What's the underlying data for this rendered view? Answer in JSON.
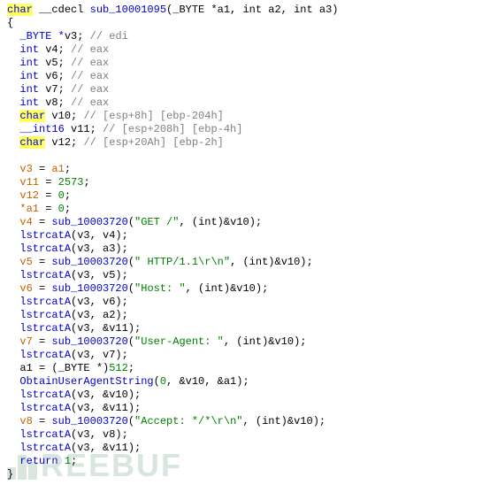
{
  "watermark": "REEBUF",
  "code": {
    "func_signature": {
      "ret_kw": "char",
      "cc": " __cdecl ",
      "name": "sub_10001095",
      "params": "(_BYTE *a1, int a2, int a3)"
    },
    "decl": [
      {
        "type": "_BYTE *",
        "name": "v3",
        "comment": "// edi"
      },
      {
        "type": "int ",
        "name": "v4",
        "comment": "// eax"
      },
      {
        "type": "int ",
        "name": "v5",
        "comment": "// eax"
      },
      {
        "type": "int ",
        "name": "v6",
        "comment": "// eax"
      },
      {
        "type": "int ",
        "name": "v7",
        "comment": "// eax"
      },
      {
        "type": "int ",
        "name": "v8",
        "comment": "// eax"
      },
      {
        "type_hl": "char",
        "type_rest": " ",
        "name": "v10",
        "comment": "// [esp+8h] [ebp-204h]"
      },
      {
        "type": "__int16 ",
        "name": "v11",
        "comment": "// [esp+208h] [ebp-4h]"
      },
      {
        "type_hl": "char",
        "type_rest": " ",
        "name": "v12",
        "comment": "// [esp+20Ah] [ebp-2h]"
      }
    ],
    "body": [
      {
        "t": "assign",
        "lhs": "v3",
        "op": " = ",
        "rhs_var": "a1"
      },
      {
        "t": "assign",
        "lhs": "v11",
        "op": " = ",
        "rhs_num": "2573"
      },
      {
        "t": "assign",
        "lhs": "v12",
        "op": " = ",
        "rhs_num": "0"
      },
      {
        "t": "assign",
        "lhs": "*a1",
        "op": " = ",
        "rhs_num": "0"
      },
      {
        "t": "call_assign",
        "lhs": "v4",
        "fn": "sub_10003720",
        "str": "\"GET /\"",
        "rest": ", (int)&v10"
      },
      {
        "t": "call",
        "fn": "lstrcatA",
        "args": "(v3, v4)"
      },
      {
        "t": "call",
        "fn": "lstrcatA",
        "args": "(v3, a3)"
      },
      {
        "t": "call_assign",
        "lhs": "v5",
        "fn": "sub_10003720",
        "str": "\" HTTP/1.1\\r\\n\"",
        "rest": ", (int)&v10"
      },
      {
        "t": "call",
        "fn": "lstrcatA",
        "args": "(v3, v5)"
      },
      {
        "t": "call_assign",
        "lhs": "v6",
        "fn": "sub_10003720",
        "str": "\"Host: \"",
        "rest": ", (int)&v10"
      },
      {
        "t": "call",
        "fn": "lstrcatA",
        "args": "(v3, v6)"
      },
      {
        "t": "call",
        "fn": "lstrcatA",
        "args": "(v3, a2)"
      },
      {
        "t": "call",
        "fn": "lstrcatA",
        "args": "(v3, &v11)"
      },
      {
        "t": "call_assign",
        "lhs": "v7",
        "fn": "sub_10003720",
        "str": "\"User-Agent: \"",
        "rest": ", (int)&v10"
      },
      {
        "t": "call",
        "fn": "lstrcatA",
        "args": "(v3, v7)"
      },
      {
        "t": "plain",
        "txt_pre": "a1 = (_BYTE *)",
        "num": "512",
        "txt_post": ";"
      },
      {
        "t": "call",
        "fn": "ObtainUserAgentString",
        "args_mixed": {
          "pre": "(",
          "num": "0",
          "post": ", &v10, &a1)"
        }
      },
      {
        "t": "call",
        "fn": "lstrcatA",
        "args": "(v3, &v10)"
      },
      {
        "t": "call",
        "fn": "lstrcatA",
        "args": "(v3, &v11)"
      },
      {
        "t": "call_assign",
        "lhs": "v8",
        "fn": "sub_10003720",
        "str": "\"Accept: */*\\r\\n\"",
        "rest": ", (int)&v10"
      },
      {
        "t": "call",
        "fn": "lstrcatA",
        "args": "(v3, v8)"
      },
      {
        "t": "call",
        "fn": "lstrcatA",
        "args": "(v3, &v11)"
      },
      {
        "t": "return",
        "kw": "return ",
        "num": "1"
      }
    ]
  }
}
